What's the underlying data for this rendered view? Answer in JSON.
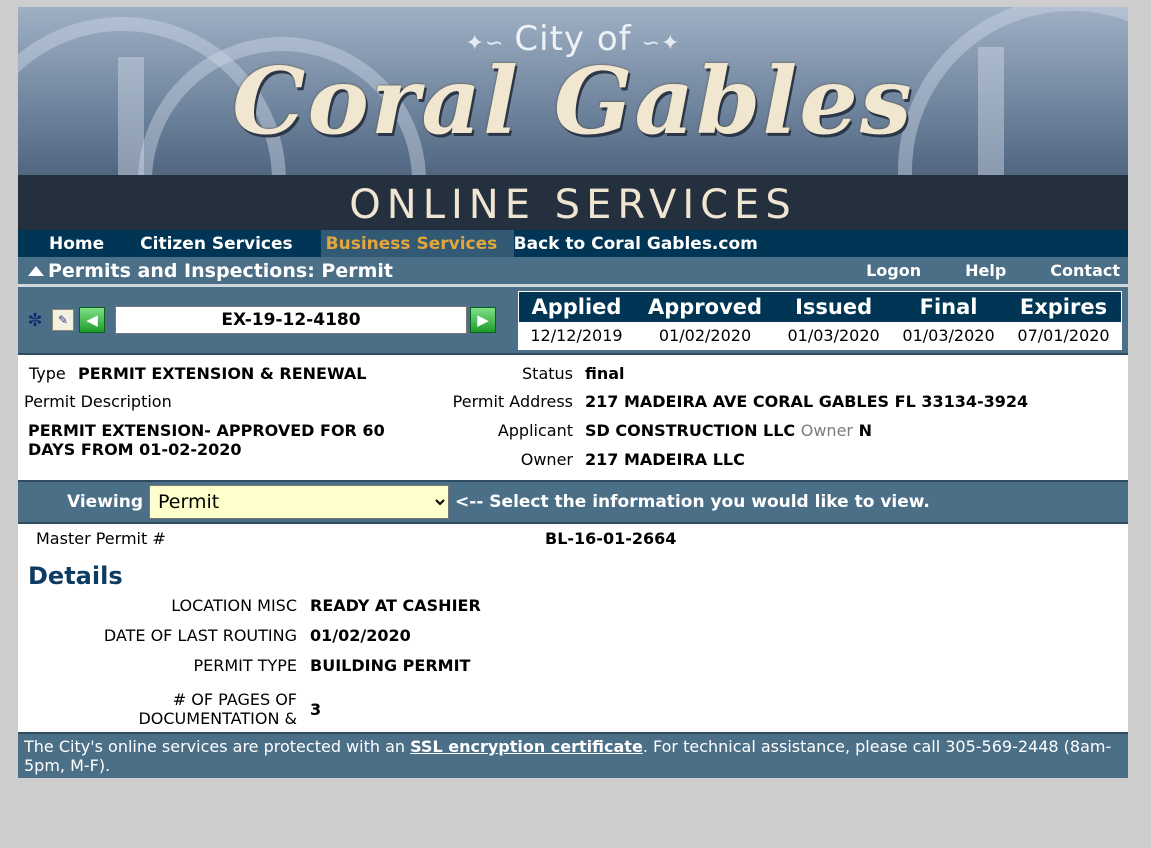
{
  "banner": {
    "city_of": "City of",
    "city_name": "Coral Gables",
    "online_services": "ONLINE SERVICES"
  },
  "nav": {
    "items": [
      "Home",
      "Citizen Services",
      "Business Services",
      "Back to Coral Gables.com"
    ],
    "active": "Business Services"
  },
  "titlebar": {
    "title": "Permits and Inspections: Permit",
    "links": [
      "Logon",
      "Help",
      "Contact"
    ]
  },
  "permit": {
    "number": "EX-19-12-4180",
    "icons": [
      "binoculars-icon",
      "edit-icon",
      "prev-arrow-icon",
      "next-arrow-icon"
    ],
    "dates": {
      "headers": [
        "Applied",
        "Approved",
        "Issued",
        "Final",
        "Expires"
      ],
      "values": [
        "12/12/2019",
        "01/02/2020",
        "01/03/2020",
        "01/03/2020",
        "07/01/2020"
      ]
    }
  },
  "info": {
    "type_label": "Type",
    "type_value": "PERMIT EXTENSION & RENEWAL",
    "description_label": "Permit Description",
    "description_value": "PERMIT EXTENSION- APPROVED FOR 60 DAYS FROM 01-02-2020",
    "status_label": "Status",
    "status_value": "final",
    "address_label": "Permit Address",
    "address_value": "217 MADEIRA AVE CORAL GABLES FL 33134-3924",
    "applicant_label": "Applicant",
    "applicant_value": "SD CONSTRUCTION LLC",
    "owner_flag_label": "Owner",
    "owner_flag_value": "N",
    "owner_label": "Owner",
    "owner_value": "217 MADEIRA LLC"
  },
  "viewing": {
    "label": "Viewing",
    "selected": "Permit",
    "hint": "<-- Select the information you would like to view."
  },
  "master": {
    "label": "Master Permit #",
    "value": "BL-16-01-2664"
  },
  "details": {
    "title": "Details",
    "rows": [
      {
        "label": "LOCATION MISC",
        "value": "READY AT CASHIER"
      },
      {
        "label": "DATE OF LAST ROUTING",
        "value": "01/02/2020"
      },
      {
        "label": "PERMIT TYPE",
        "value": "BUILDING PERMIT"
      },
      {
        "label": "# OF PAGES OF DOCUMENTATION &",
        "value": "3"
      }
    ]
  },
  "footer": {
    "text_before": "The City's online services are protected with an ",
    "link": "SSL encryption certificate",
    "text_after": ". For technical assistance, please call 305-569-2448 (8am-5pm, M-F)."
  },
  "colors": {
    "nav_bg": "#003555",
    "bar_bg": "#4c6f88",
    "active_nav": "#e3a63a",
    "select_bg": "#ffffcc",
    "details_title": "#0d3b61"
  }
}
